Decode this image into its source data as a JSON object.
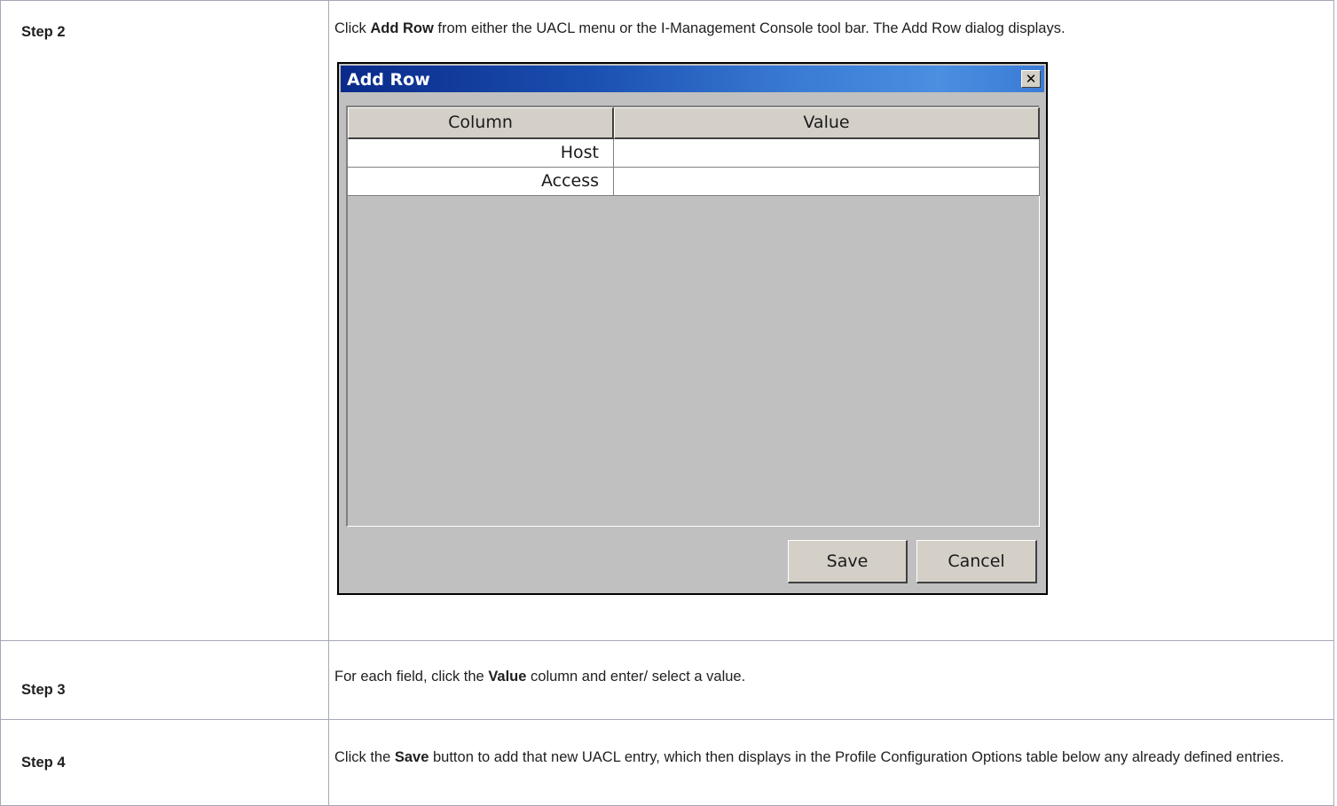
{
  "steps": [
    {
      "label": "Step 2",
      "desc_pre": "Click ",
      "desc_bold": "Add Row",
      "desc_post": " from either the UACL menu or the I-Management Console tool bar. The Add Row dialog displays."
    },
    {
      "label": "Step 3",
      "desc_pre": "For each field, click the ",
      "desc_bold": "Value",
      "desc_post": " column and enter/ select a value."
    },
    {
      "label": "Step 4",
      "desc_pre": "Click the ",
      "desc_bold": "Save",
      "desc_post": " button to add that new UACL entry, which then displays in the Profile Configuration Options table below any already defined entries."
    }
  ],
  "dialog": {
    "title": "Add Row",
    "close_glyph": "✕",
    "columns": [
      "Column",
      "Value"
    ],
    "rows": [
      {
        "name": "Host",
        "value": ""
      },
      {
        "name": "Access",
        "value": ""
      }
    ],
    "save_label": "Save",
    "cancel_label": "Cancel"
  }
}
